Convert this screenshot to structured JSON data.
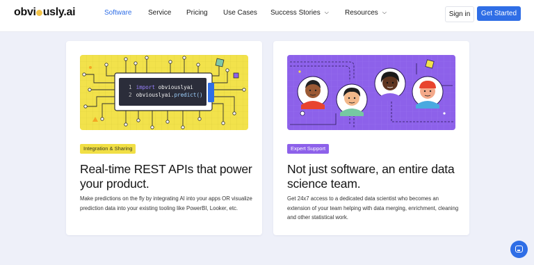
{
  "brand": {
    "logo_text_before": "obvi",
    "logo_text_after": "usly.ai"
  },
  "nav": {
    "items": [
      {
        "label": "Software",
        "active": true
      },
      {
        "label": "Service"
      },
      {
        "label": "Pricing"
      },
      {
        "label": "Use Cases"
      },
      {
        "label": "Success Stories",
        "dropdown": true
      },
      {
        "label": "Resources",
        "dropdown": true
      }
    ],
    "sign_in": "Sign in",
    "get_started": "Get Started"
  },
  "cards": [
    {
      "tag": "Integration & Sharing",
      "title": "Real-time REST APIs that power your product.",
      "body": "Make predictions on the fly by integrating AI into your apps OR visualize prediction data into your existing tooling like PowerBI, Looker, etc.",
      "code": {
        "line1_no": "1",
        "line1_keyword": "import",
        "line1_rest": " obviouslyai",
        "line2_no": "2",
        "line2_text": "obviouslyai.",
        "line2_call": "predict()"
      }
    },
    {
      "tag": "Expert Support",
      "title": "Not just software, an entire data science team.",
      "body": "Get 24x7 access to a dedicated data scientist who becomes an extension of your team helping with data merging, enrichment, cleaning and other statistical work."
    }
  ],
  "colors": {
    "accent": "#2f6ee6",
    "yellow_illustration": "#f2e24b",
    "purple_illustration": "#8d61ea",
    "page_background": "#eef0f9"
  },
  "icons": {
    "chat_launcher": "chat-bubble-icon",
    "dropdown": "chevron-down-icon"
  }
}
